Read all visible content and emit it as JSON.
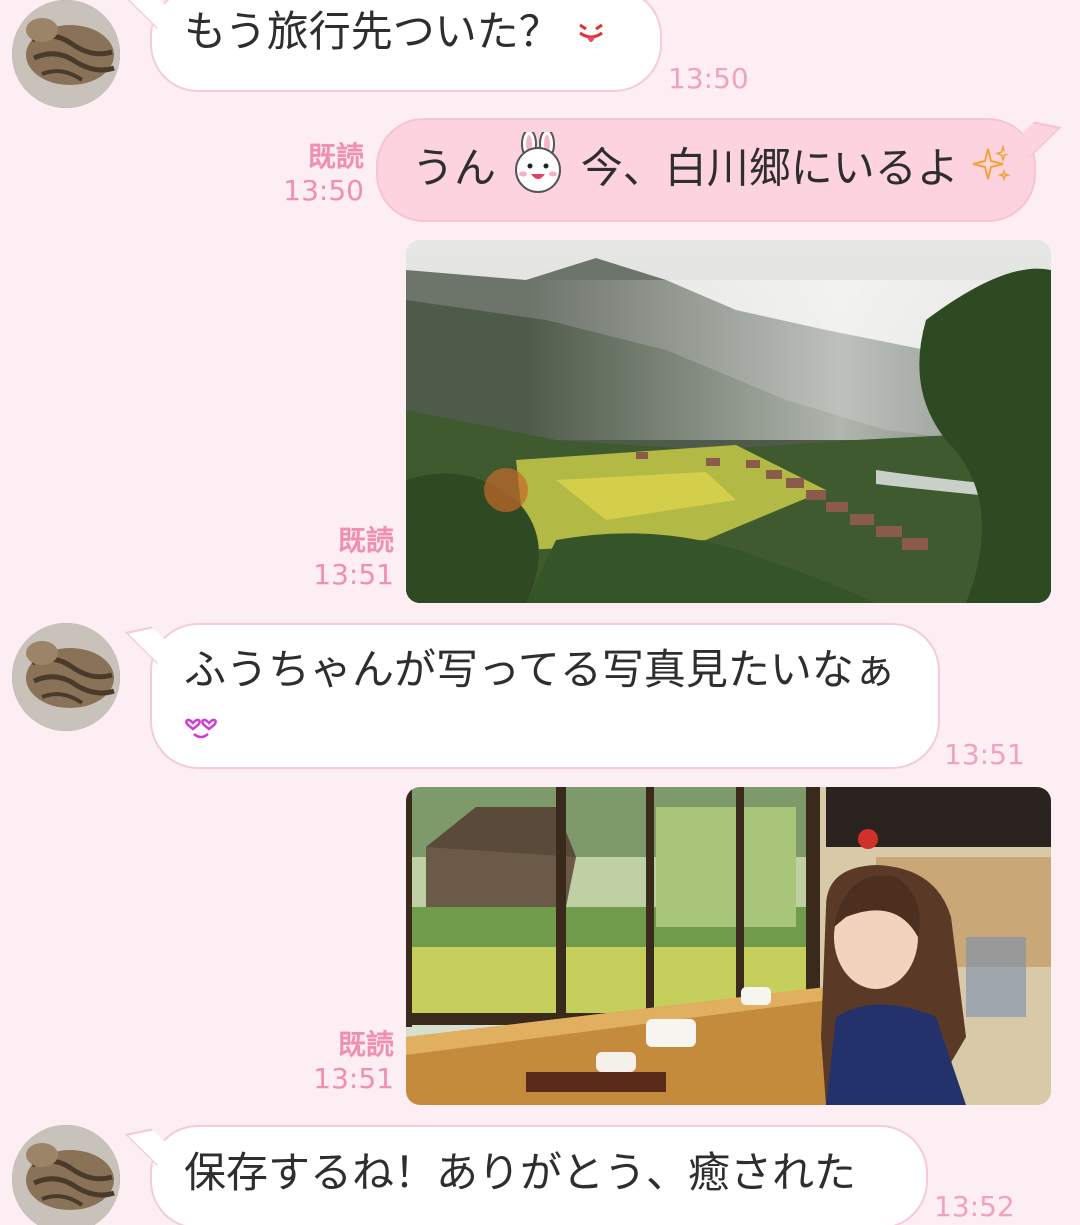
{
  "messages": [
    {
      "sender": "other",
      "text": "もう旅行先ついた？",
      "emoji": "tongue-face-icon",
      "time": "13:50"
    },
    {
      "sender": "me",
      "text_before": "うん",
      "sticker": "bunny-face-icon",
      "text_after": "今、白川郷にいるよ",
      "emoji": "sparkles-icon",
      "read": "既読",
      "time": "13:50"
    },
    {
      "sender": "me",
      "type": "photo",
      "photo": "shirakawa-village-valley",
      "read": "既読",
      "time": "13:51"
    },
    {
      "sender": "other",
      "text": "ふうちゃんが写ってる写真見たいなぁ",
      "emoji": "heart-eyes-face-icon",
      "time": "13:51"
    },
    {
      "sender": "me",
      "type": "photo",
      "photo": "cafe-window-portrait",
      "read": "既読",
      "time": "13:51"
    },
    {
      "sender": "other",
      "text": "保存するね！ありがとう、癒された",
      "time": "13:52"
    }
  ],
  "colors": {
    "background": "#fceef3",
    "incoming_bubble": "#ffffff",
    "outgoing_bubble": "#fcd3df",
    "timestamp": "#f1a3b9",
    "read_receipt": "#f08fae"
  }
}
